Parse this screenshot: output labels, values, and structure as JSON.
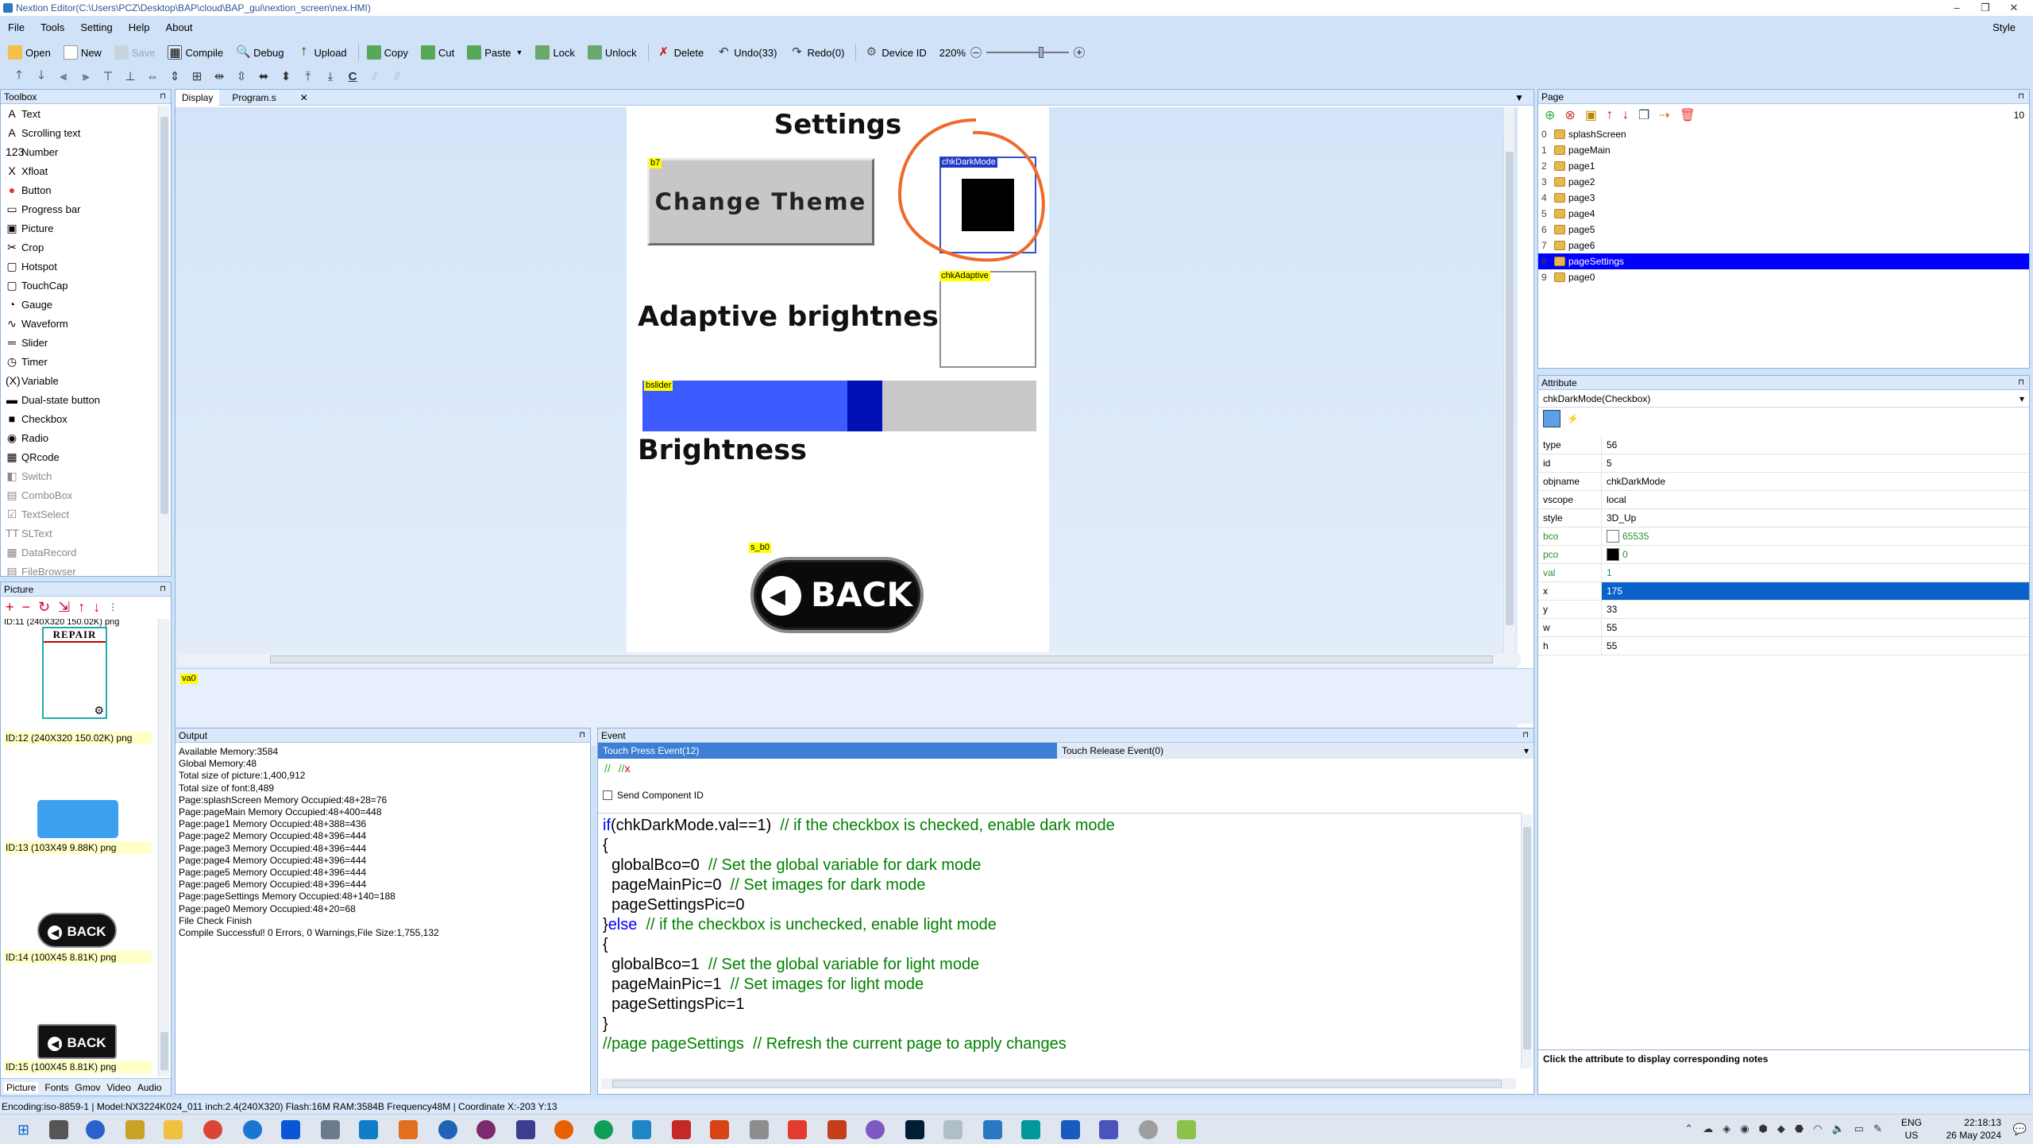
{
  "window": {
    "title": "Nextion Editor(C:\\Users\\PCZ\\Desktop\\BAP\\cloud\\BAP_gui\\nextion_screen\\nex.HMI)"
  },
  "menu": {
    "items": [
      "File",
      "Tools",
      "Setting",
      "Help",
      "About"
    ],
    "style": "Style"
  },
  "toolbar": {
    "open": "Open",
    "new": "New",
    "save": "Save",
    "compile": "Compile",
    "debug": "Debug",
    "upload": "Upload",
    "copy": "Copy",
    "cut": "Cut",
    "paste": "Paste",
    "lock": "Lock",
    "unlock": "Unlock",
    "delete": "Delete",
    "undo": "Undo(33)",
    "redo": "Redo(0)",
    "device_id": "Device ID",
    "zoom": "220%"
  },
  "toolbox": {
    "title": "Toolbox",
    "items": [
      "Text",
      "Scrolling text",
      "Number",
      "Xfloat",
      "Button",
      "Progress bar",
      "Picture",
      "Crop",
      "Hotspot",
      "TouchCap",
      "Gauge",
      "Waveform",
      "Slider",
      "Timer",
      "Variable",
      "Dual-state button",
      "Checkbox",
      "Radio",
      "QRcode",
      "Switch",
      "ComboBox",
      "TextSelect",
      "SLText",
      "DataRecord",
      "FileBrowser"
    ]
  },
  "picture_panel": {
    "title": "Picture",
    "top_label": "ID:11  (240X320 150.02K) png",
    "repair_text": "REPAIR",
    "items": [
      "ID:12  (240X320 150.02K) png",
      "ID:13  (103X49 9.88K) png",
      "ID:14  (100X45 8.81K) png",
      "ID:15  (100X45 8.81K) png"
    ],
    "back_text": "BACK",
    "tabs": [
      "Picture",
      "Fonts",
      "Gmov",
      "Video",
      "Audio"
    ]
  },
  "editor": {
    "tabs": [
      "Display",
      "Program.s"
    ],
    "screen": {
      "title": "Settings",
      "b7_tag": "b7",
      "change_theme": "Change Theme",
      "chk_dark_tag": "chkDarkMode",
      "adaptive": "Adaptive brightness",
      "chk_adaptive_tag": "chkAdaptive",
      "slider_tag": "bslider",
      "slider_value": 0.56,
      "brightness": "Brightness",
      "back_tag": "s_b0",
      "back_text": "BACK"
    },
    "variable_tag": "va0"
  },
  "page_panel": {
    "title": "Page",
    "count": "10",
    "pages": [
      {
        "num": "0",
        "name": "splashScreen"
      },
      {
        "num": "1",
        "name": "pageMain"
      },
      {
        "num": "2",
        "name": "page1"
      },
      {
        "num": "3",
        "name": "page2"
      },
      {
        "num": "4",
        "name": "page3"
      },
      {
        "num": "5",
        "name": "page4"
      },
      {
        "num": "6",
        "name": "page5"
      },
      {
        "num": "7",
        "name": "page6"
      },
      {
        "num": "8",
        "name": "pageSettings"
      },
      {
        "num": "9",
        "name": "page0"
      }
    ],
    "selected": "pageSettings"
  },
  "attribute_panel": {
    "title": "Attribute",
    "selected_object": "chkDarkMode(Checkbox)",
    "rows": [
      {
        "k": "type",
        "v": "56"
      },
      {
        "k": "id",
        "v": "5"
      },
      {
        "k": "objname",
        "v": "chkDarkMode"
      },
      {
        "k": "vscope",
        "v": "local"
      },
      {
        "k": "style",
        "v": "3D_Up"
      },
      {
        "k": "bco",
        "v": "65535"
      },
      {
        "k": "pco",
        "v": "0"
      },
      {
        "k": "val",
        "v": "1"
      },
      {
        "k": "x",
        "v": "175"
      },
      {
        "k": "y",
        "v": "33"
      },
      {
        "k": "w",
        "v": "55"
      },
      {
        "k": "h",
        "v": "55"
      }
    ],
    "colors": {
      "bco": "#ffffff",
      "pco": "#000000"
    },
    "note": "Click the attribute to display corresponding notes"
  },
  "output_panel": {
    "title": "Output",
    "lines": [
      "Available Memory:3584",
      "Global Memory:48",
      "Total size of picture:1,400,912",
      "Total size of font:8,489",
      "Page:splashScreen Memory Occupied:48+28=76",
      "Page:pageMain Memory Occupied:48+400=448",
      "Page:page1 Memory Occupied:48+388=436",
      "Page:page2 Memory Occupied:48+396=444",
      "Page:page3 Memory Occupied:48+396=444",
      "Page:page4 Memory Occupied:48+396=444",
      "Page:page5 Memory Occupied:48+396=444",
      "Page:page6 Memory Occupied:48+396=444",
      "Page:pageSettings Memory Occupied:48+140=188",
      "Page:page0 Memory Occupied:48+20=68",
      "File Check Finish",
      "Compile Successful! 0 Errors, 0 Warnings,File Size:1,755,132"
    ]
  },
  "event_panel": {
    "title": "Event",
    "tab_press": "Touch Press Event(12)",
    "tab_release": "Touch Release Event(0)",
    "send_component_id": "Send Component ID",
    "code": [
      {
        "kw": "if",
        "text": "(chkDarkMode.val==1)  ",
        "cm": "// if the checkbox is checked, enable dark mode"
      },
      {
        "kw": "",
        "text": "{",
        "cm": ""
      },
      {
        "kw": "",
        "text": "  globalBco=0  ",
        "cm": "// Set the global variable for dark mode"
      },
      {
        "kw": "",
        "text": "  pageMainPic=0  ",
        "cm": "// Set images for dark mode"
      },
      {
        "kw": "",
        "text": "  pageSettingsPic=0",
        "cm": ""
      },
      {
        "kw": "else",
        "text": "}",
        "cm": "  // if the checkbox is unchecked, enable light mode"
      },
      {
        "kw": "",
        "text": "{",
        "cm": ""
      },
      {
        "kw": "",
        "text": "  globalBco=1  ",
        "cm": "// Set the global variable for light mode"
      },
      {
        "kw": "",
        "text": "  pageMainPic=1  ",
        "cm": "// Set images for light mode"
      },
      {
        "kw": "",
        "text": "  pageSettingsPic=1",
        "cm": ""
      },
      {
        "kw": "",
        "text": "}",
        "cm": ""
      },
      {
        "kw": "",
        "text": "",
        "cm": "//page pageSettings  // Refresh the current page to apply changes"
      }
    ]
  },
  "statusbar": {
    "text": "Encoding:iso-8859-1 | Model:NX3224K024_011 inch:2.4(240X320) Flash:16M RAM:3584B Frequency48M |   Coordinate X:-203  Y:13"
  },
  "taskbar": {
    "lang1": "ENG",
    "lang2": "US",
    "time": "22:18:13",
    "date": "26 May 2024"
  }
}
